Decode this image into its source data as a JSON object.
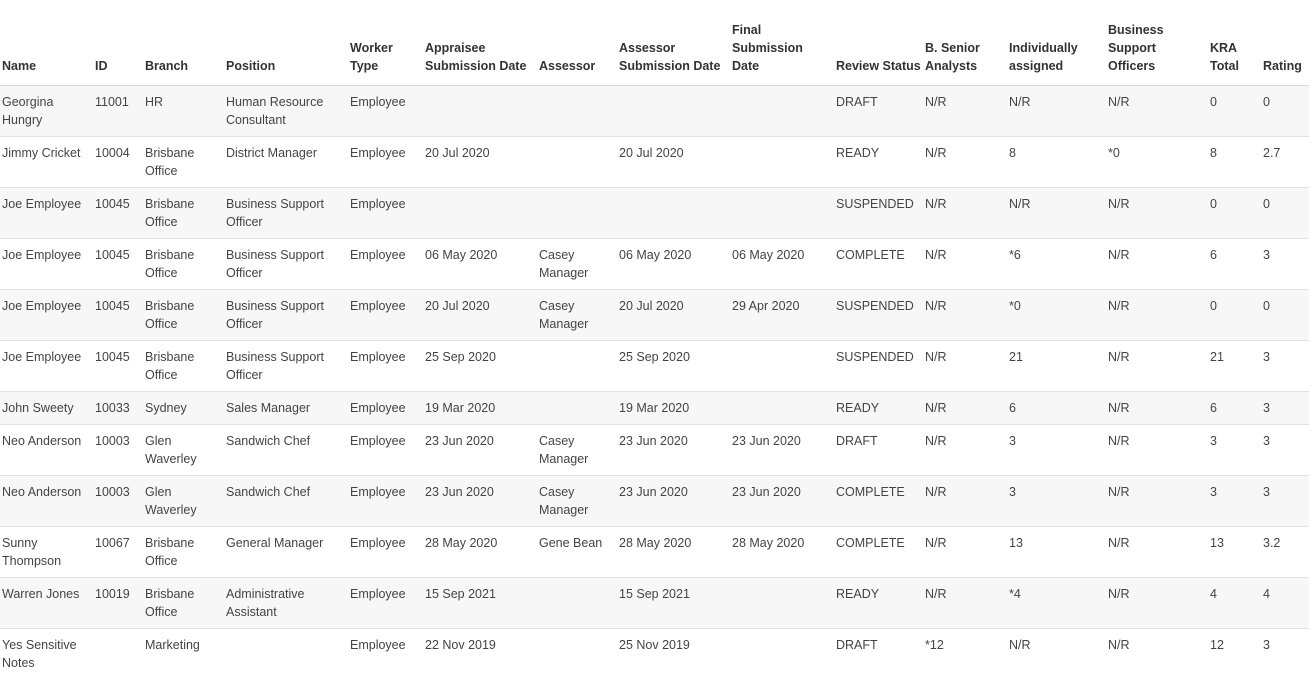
{
  "columns": [
    "Name",
    "ID",
    "Branch",
    "Position",
    "Worker Type",
    "Appraisee Submission Date",
    "Assessor",
    "Assessor Submission Date",
    "Final Submission Date",
    "Review Status",
    "B. Senior Analysts",
    "Individually assigned",
    "Business Support Officers",
    "KRA Total",
    "Rating"
  ],
  "rows": [
    [
      "Georgina Hungry",
      "11001",
      "HR",
      "Human Resource Consultant",
      "Employee",
      "",
      "",
      "",
      "",
      "DRAFT",
      "N/R",
      "N/R",
      "N/R",
      "0",
      "0"
    ],
    [
      "Jimmy Cricket",
      "10004",
      "Brisbane Office",
      "District Manager",
      "Employee",
      "20 Jul 2020",
      "",
      "20 Jul 2020",
      "",
      "READY",
      "N/R",
      "8",
      "*0",
      "8",
      "2.7"
    ],
    [
      "Joe Employee",
      "10045",
      "Brisbane Office",
      "Business Support Officer",
      "Employee",
      "",
      "",
      "",
      "",
      "SUSPENDED",
      "N/R",
      "N/R",
      "N/R",
      "0",
      "0"
    ],
    [
      "Joe Employee",
      "10045",
      "Brisbane Office",
      "Business Support Officer",
      "Employee",
      "06 May 2020",
      "Casey Manager",
      "06 May 2020",
      "06 May 2020",
      "COMPLETE",
      "N/R",
      "*6",
      "N/R",
      "6",
      "3"
    ],
    [
      "Joe Employee",
      "10045",
      "Brisbane Office",
      "Business Support Officer",
      "Employee",
      "20 Jul 2020",
      "Casey Manager",
      "20 Jul 2020",
      "29 Apr 2020",
      "SUSPENDED",
      "N/R",
      "*0",
      "N/R",
      "0",
      "0"
    ],
    [
      "Joe Employee",
      "10045",
      "Brisbane Office",
      "Business Support Officer",
      "Employee",
      "25 Sep 2020",
      "",
      "25 Sep 2020",
      "",
      "SUSPENDED",
      "N/R",
      "21",
      "N/R",
      "21",
      "3"
    ],
    [
      "John Sweety",
      "10033",
      "Sydney",
      "Sales Manager",
      "Employee",
      "19 Mar 2020",
      "",
      "19 Mar 2020",
      "",
      "READY",
      "N/R",
      "6",
      "N/R",
      "6",
      "3"
    ],
    [
      "Neo Anderson",
      "10003",
      "Glen Waverley",
      "Sandwich Chef",
      "Employee",
      "23 Jun 2020",
      "Casey Manager",
      "23 Jun 2020",
      "23 Jun 2020",
      "DRAFT",
      "N/R",
      "3",
      "N/R",
      "3",
      "3"
    ],
    [
      "Neo Anderson",
      "10003",
      "Glen Waverley",
      "Sandwich Chef",
      "Employee",
      "23 Jun 2020",
      "Casey Manager",
      "23 Jun 2020",
      "23 Jun 2020",
      "COMPLETE",
      "N/R",
      "3",
      "N/R",
      "3",
      "3"
    ],
    [
      "Sunny Thompson",
      "10067",
      "Brisbane Office",
      "General Manager",
      "Employee",
      "28 May 2020",
      "Gene Bean",
      "28 May 2020",
      "28 May 2020",
      "COMPLETE",
      "N/R",
      "13",
      "N/R",
      "13",
      "3.2"
    ],
    [
      "Warren Jones",
      "10019",
      "Brisbane Office",
      "Administrative Assistant",
      "Employee",
      "15 Sep 2021",
      "",
      "15 Sep 2021",
      "",
      "READY",
      "N/R",
      "*4",
      "N/R",
      "4",
      "4"
    ],
    [
      "Yes Sensitive Notes",
      "",
      "Marketing",
      "",
      "Employee",
      "22 Nov 2019",
      "",
      "25 Nov 2019",
      "",
      "DRAFT",
      "*12",
      "N/R",
      "N/R",
      "12",
      "3"
    ]
  ]
}
